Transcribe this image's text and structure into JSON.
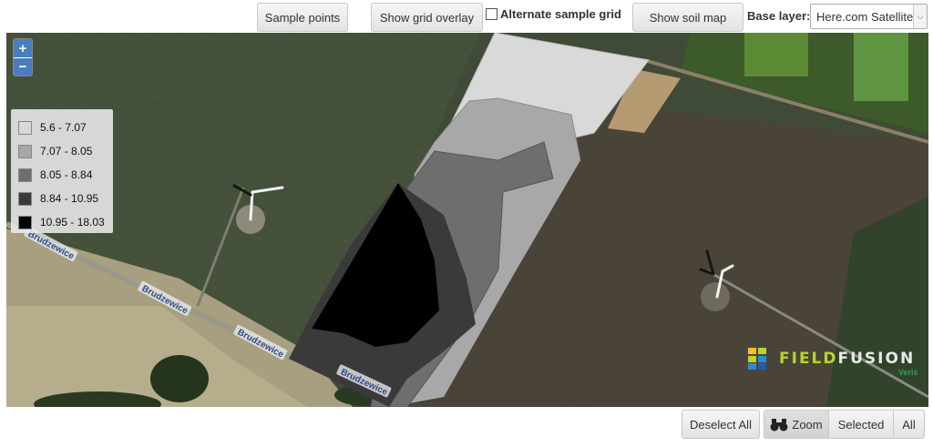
{
  "toolbar": {
    "sample_points": "Sample points",
    "show_grid_overlay": "Show grid overlay",
    "alternate_sample_grid": "Alternate sample grid",
    "show_soil_map": "Show soil map",
    "base_layer_label": "Base layer:",
    "base_layer_value": "Here.com Satellite"
  },
  "map": {
    "zoom_in": "+",
    "zoom_out": "−",
    "roads": [
      "Brudzewice",
      "Brudzewice",
      "Brudzewice",
      "Brudzewice"
    ],
    "legend": [
      {
        "label": "5.6 - 7.07",
        "color": "#d9d9d9"
      },
      {
        "label": "7.07 - 8.05",
        "color": "#a8a8a8"
      },
      {
        "label": "8.05 - 8.84",
        "color": "#6e6e6e"
      },
      {
        "label": "8.84 - 10.95",
        "color": "#3a3a3a"
      },
      {
        "label": "10.95 - 18.03",
        "color": "#000000"
      }
    ],
    "logo": {
      "part1": "FIELD",
      "part2": "FUSION",
      "sub": "Veris"
    }
  },
  "bottom": {
    "deselect_all": "Deselect All",
    "zoom": "Zoom",
    "selected": "Selected",
    "all": "All"
  }
}
